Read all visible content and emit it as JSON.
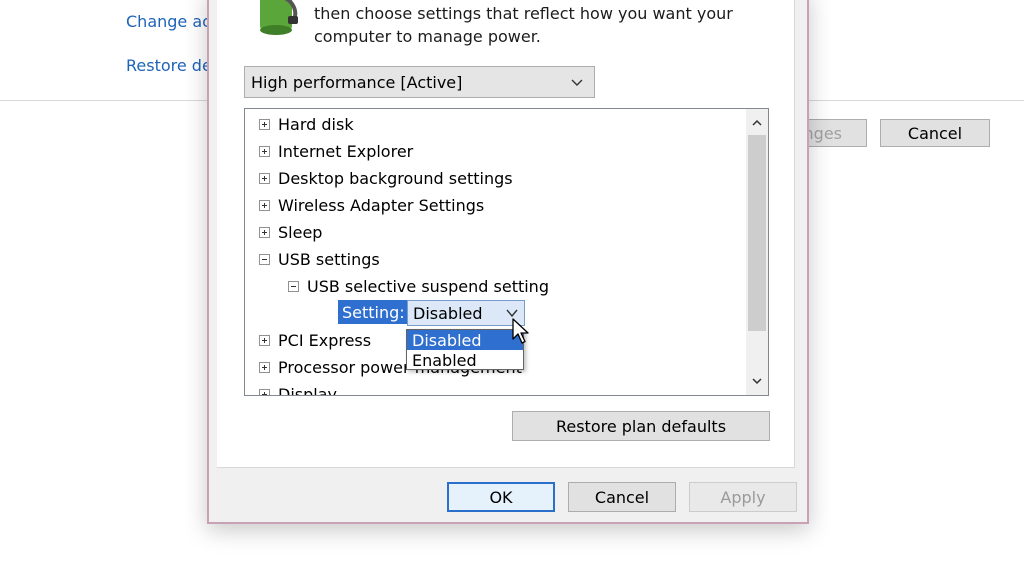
{
  "background": {
    "links": [
      "Change ac",
      "Restore de"
    ],
    "save_button_label": "nges",
    "cancel_button_label": "Cancel"
  },
  "dialog": {
    "description": "then choose settings that reflect how you want your computer to manage power.",
    "plan_select_value": "High performance [Active]",
    "tree": [
      {
        "label": "Hard disk",
        "state": "collapsed"
      },
      {
        "label": "Internet Explorer",
        "state": "collapsed"
      },
      {
        "label": "Desktop background settings",
        "state": "collapsed"
      },
      {
        "label": "Wireless Adapter Settings",
        "state": "collapsed"
      },
      {
        "label": "Sleep",
        "state": "collapsed"
      },
      {
        "label": "USB settings",
        "state": "expanded"
      },
      {
        "label": "USB selective suspend setting",
        "state": "expanded"
      },
      {
        "label": "PCI Express",
        "state": "collapsed"
      },
      {
        "label": "Processor power management",
        "state": "collapsed"
      },
      {
        "label": "Display",
        "state": "collapsed"
      }
    ],
    "setting": {
      "label": "Setting:",
      "value": "Disabled",
      "options": [
        "Disabled",
        "Enabled"
      ],
      "highlighted_option": "Disabled"
    },
    "restore_defaults_label": "Restore plan defaults",
    "buttons": {
      "ok": "OK",
      "cancel": "Cancel",
      "apply": "Apply"
    }
  },
  "colors": {
    "selection": "#2f6fcf",
    "link": "#1e63b8",
    "dialog_border": "#c9a1b4"
  }
}
